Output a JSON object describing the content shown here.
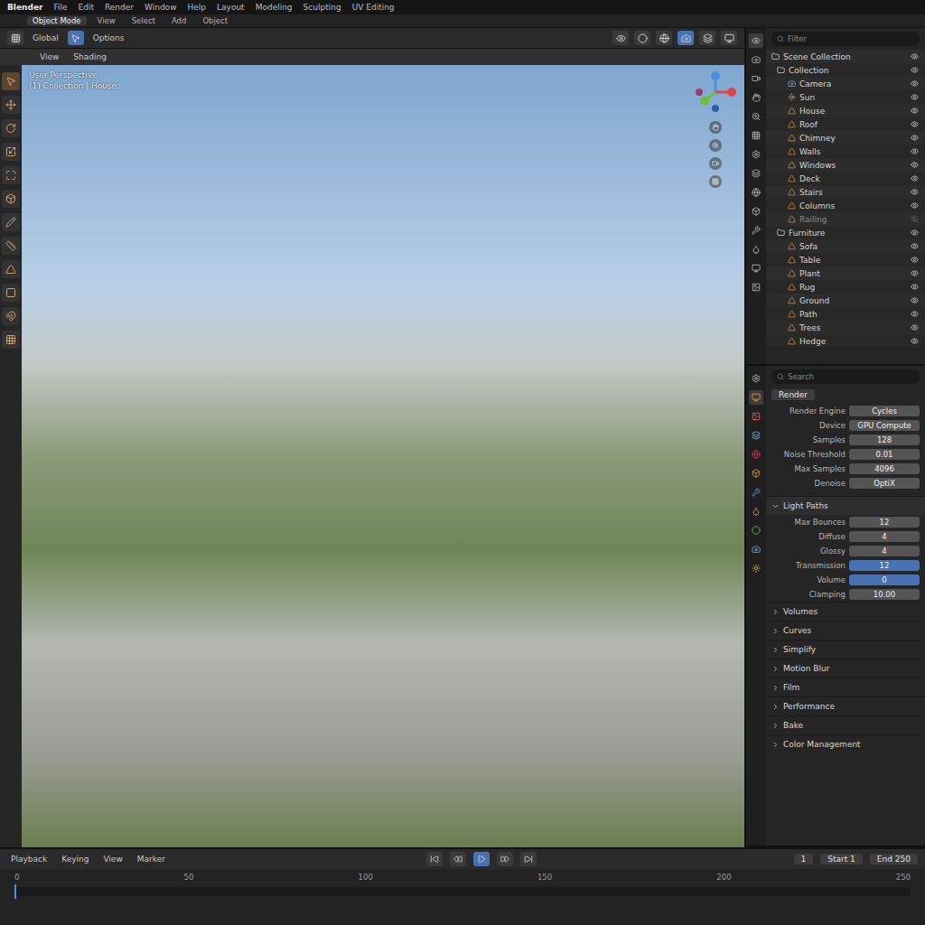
{
  "window": {
    "title": "Blender"
  },
  "menu": [
    "File",
    "Edit",
    "Render",
    "Window",
    "Help",
    "Layout",
    "Modeling",
    "Sculpting",
    "UV Editing"
  ],
  "header": [
    {
      "label": "Object Mode",
      "selected": true
    },
    {
      "label": "View",
      "selected": false
    },
    {
      "label": "Select",
      "selected": false
    },
    {
      "label": "Add",
      "selected": false
    },
    {
      "label": "Object",
      "selected": false
    }
  ],
  "tool_row": [
    "Global",
    "Options"
  ],
  "viewport": {
    "header": [
      "View",
      "Shading"
    ],
    "info": [
      "User Perspective",
      "(1) Collection | House"
    ]
  },
  "outliner": {
    "search": {
      "placeholder": "Filter"
    },
    "items": [
      {
        "name": "Scene Collection",
        "kind": "collection",
        "visible": true
      },
      {
        "name": "Collection",
        "kind": "collection",
        "visible": true
      },
      {
        "name": "Camera",
        "kind": "camera",
        "visible": true
      },
      {
        "name": "Sun",
        "kind": "light",
        "visible": true
      },
      {
        "name": "House",
        "kind": "mesh",
        "visible": true
      },
      {
        "name": "Roof",
        "kind": "mesh",
        "visible": true
      },
      {
        "name": "Chimney",
        "kind": "mesh",
        "visible": true
      },
      {
        "name": "Walls",
        "kind": "mesh",
        "visible": true
      },
      {
        "name": "Windows",
        "kind": "mesh",
        "visible": true
      },
      {
        "name": "Deck",
        "kind": "mesh",
        "visible": true
      },
      {
        "name": "Stairs",
        "kind": "mesh",
        "visible": true
      },
      {
        "name": "Columns",
        "kind": "mesh",
        "visible": true
      },
      {
        "name": "Railing",
        "kind": "mesh",
        "visible": false
      },
      {
        "name": "Furniture",
        "kind": "collection",
        "visible": true
      },
      {
        "name": "Sofa",
        "kind": "mesh",
        "visible": true
      },
      {
        "name": "Table",
        "kind": "mesh",
        "visible": true
      },
      {
        "name": "Plant",
        "kind": "mesh",
        "visible": true
      },
      {
        "name": "Rug",
        "kind": "mesh",
        "visible": true
      },
      {
        "name": "Ground",
        "kind": "mesh",
        "visible": true
      },
      {
        "name": "Path",
        "kind": "mesh",
        "visible": true
      },
      {
        "name": "Trees",
        "kind": "mesh",
        "visible": true
      },
      {
        "name": "Hedge",
        "kind": "mesh",
        "visible": true
      }
    ]
  },
  "properties": {
    "search": {
      "placeholder": "Search"
    },
    "context": "Render",
    "fields": [
      {
        "label": "Render Engine",
        "value": "Cycles",
        "selected": false
      },
      {
        "label": "Device",
        "value": "GPU Compute",
        "selected": false
      },
      {
        "label": "Samples",
        "value": "128",
        "selected": false
      },
      {
        "label": "Noise Threshold",
        "value": "0.01",
        "selected": false
      },
      {
        "label": "Max Samples",
        "value": "4096",
        "selected": false
      },
      {
        "label": "Denoise",
        "value": "OptiX",
        "selected": false
      }
    ],
    "section": {
      "title": "Light Paths",
      "expanded": true
    },
    "section_fields": [
      {
        "label": "Max Bounces",
        "value": "12",
        "selected": false
      },
      {
        "label": "Diffuse",
        "value": "4",
        "selected": false
      },
      {
        "label": "Glossy",
        "value": "4",
        "selected": false
      },
      {
        "label": "Transmission",
        "value": "12",
        "selected": true
      },
      {
        "label": "Volume",
        "value": "0",
        "selected": true
      },
      {
        "label": "Clamping",
        "value": "10.00",
        "selected": false
      }
    ],
    "collapsed": [
      "Volumes",
      "Curves",
      "Simplify",
      "Motion Blur",
      "Film",
      "Performance",
      "Bake",
      "Color Management"
    ]
  },
  "timeline": {
    "menus": [
      "Playback",
      "Keying",
      "View",
      "Marker"
    ],
    "frame": "1",
    "start": "Start 1",
    "end": "End 250",
    "ticks": [
      "0",
      "50",
      "100",
      "150",
      "200",
      "250"
    ],
    "level": 0.0
  }
}
